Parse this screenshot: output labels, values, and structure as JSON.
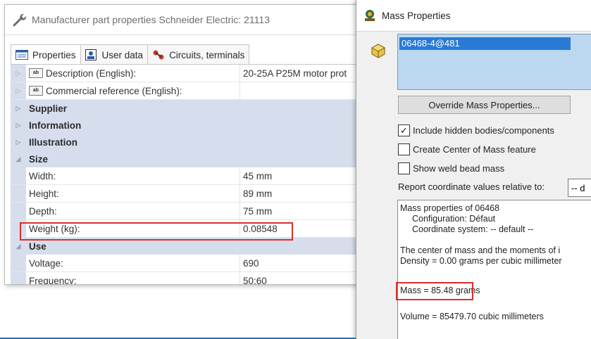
{
  "left_window": {
    "title": "Manufacturer part properties Schneider Electric: 21113",
    "tabs": [
      {
        "label": "Properties",
        "active": true,
        "icon": "properties-icon"
      },
      {
        "label": "User data",
        "active": false,
        "icon": "user-data-icon"
      },
      {
        "label": "Circuits, terminals",
        "active": false,
        "icon": "circuits-icon"
      }
    ],
    "rows": [
      {
        "type": "item",
        "name": "Description (English):",
        "value": "20-25A P25M motor prot",
        "icon": "text-field-icon"
      },
      {
        "type": "item",
        "name": "Commercial reference (English):",
        "value": "",
        "icon": "text-field-icon"
      },
      {
        "type": "category",
        "name": "Supplier",
        "expanded": false
      },
      {
        "type": "category",
        "name": "Information",
        "expanded": false
      },
      {
        "type": "category",
        "name": "Illustration",
        "expanded": false
      },
      {
        "type": "category",
        "name": "Size",
        "expanded": true
      },
      {
        "type": "item",
        "name": "Width:",
        "value": "45 mm"
      },
      {
        "type": "item",
        "name": "Height:",
        "value": "89 mm"
      },
      {
        "type": "item",
        "name": "Depth:",
        "value": "75 mm"
      },
      {
        "type": "item",
        "name": "Weight (kg):",
        "value": "0.08548",
        "highlighted": true
      },
      {
        "type": "category",
        "name": "Use",
        "expanded": true
      },
      {
        "type": "item",
        "name": "Voltage:",
        "value": "690"
      },
      {
        "type": "item",
        "name": "Frequency:",
        "value": "50;60"
      }
    ]
  },
  "right_window": {
    "title": "Mass Properties",
    "selected_item": "06468-4@481",
    "override_button": "Override Mass Properties...",
    "checkboxes": [
      {
        "label": "Include hidden bodies/components",
        "checked": true
      },
      {
        "label": "Create Center of Mass feature",
        "checked": false
      },
      {
        "label": "Show weld bead mass",
        "checked": false
      }
    ],
    "report_label": "Report coordinate values relative to:",
    "report_value": "-- d",
    "results": {
      "line1": "Mass properties of 06468",
      "line2": "Configuration: Défaut",
      "line3": "Coordinate system: -- default --",
      "line4": "The center of mass and the moments of i",
      "line5": "Density = 0.00 grams per cubic millimeter",
      "mass": "Mass = 85.48 grams",
      "volume": "Volume = 85479.70 cubic millimeters"
    }
  },
  "colors": {
    "highlight": "#d9302b",
    "category_row": "#d6deed",
    "selection": "#2a7ad5",
    "list_bg": "#bcd8f0"
  }
}
